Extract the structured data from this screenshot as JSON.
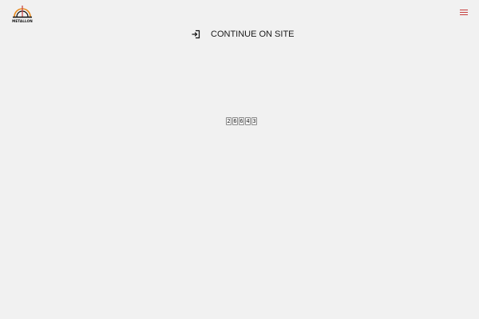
{
  "header": {
    "logo_text": "METALLON",
    "logo_icon": "dome-arch-logo-icon",
    "menu_icon": "hamburger-menu-icon"
  },
  "continue": {
    "label": "CONTINUE ON SITE",
    "icon": "login-arrow-icon"
  },
  "counter": {
    "digits": [
      "2",
      "6",
      "6",
      "4",
      "3"
    ]
  },
  "colors": {
    "background": "#f1f1f1",
    "accent": "#c63c3c",
    "logo_orange": "#e8891c"
  }
}
